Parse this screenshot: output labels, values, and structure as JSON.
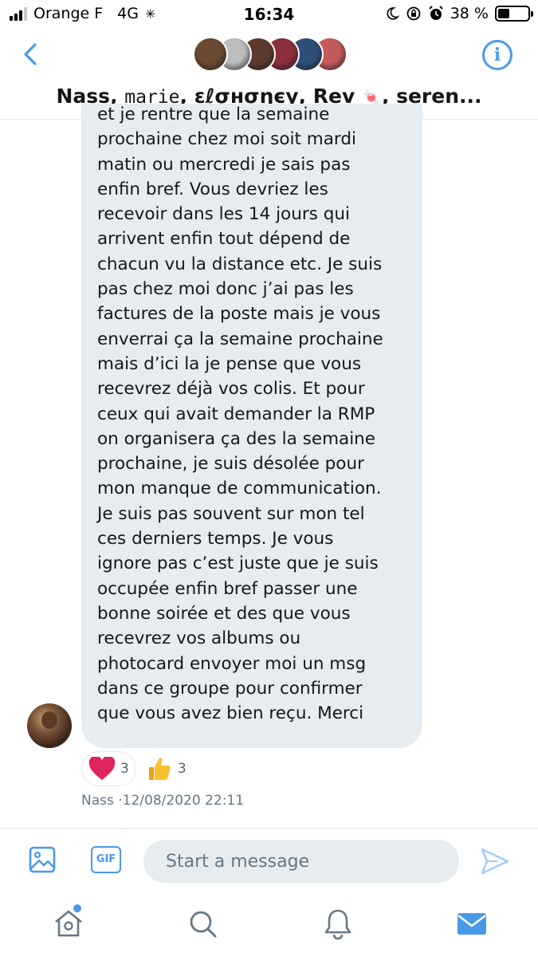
{
  "status_bar": {
    "carrier": "Orange F",
    "network": "4G",
    "time": "16:34",
    "battery_percent": "38 %",
    "battery_level": 0.38
  },
  "header": {
    "title_parts": [
      "Nass, ",
      "marie",
      ", ɛℓσнσηєу, Rev ",
      "🍬",
      ", seren..."
    ],
    "avatar_colors": [
      "#6b4a32",
      "#bdbdbd",
      "#5c3a2e",
      "#8a2f3c",
      "#2f4f7a",
      "#c45a5a"
    ]
  },
  "message": {
    "lines": [
      "et je rentre que la semaine",
      "prochaine chez moi soit mardi",
      "matin ou mercredi je sais pas",
      "enfin bref. Vous devriez les",
      "recevoir dans les 14 jours qui",
      "arrivent enfin tout dépend de",
      "chacun vu la distance etc. Je suis",
      "pas chez moi donc j’ai pas les",
      "factures de la poste mais je vous",
      "enverrai ça la semaine prochaine",
      "mais d’ici la je pense que vous",
      "recevrez déjà vos colis. Et pour",
      "ceux qui avait demander la RMP",
      "on organisera ça des la semaine",
      "prochaine, je suis désolée pour",
      "mon manque de communication.",
      "Je suis pas souvent sur mon tel",
      "ces derniers temps. Je vous",
      "ignore pas c’est juste que je suis",
      "occupée enfin bref passer une",
      "bonne soirée et des que vous",
      "recevrez vos albums ou",
      "photocard envoyer moi un msg",
      "dans ce groupe pour confirmer",
      "que vous avez bien reçu. Merci"
    ],
    "reactions": [
      {
        "emoji": "heart",
        "count": "3"
      },
      {
        "emoji": "thumbs-up",
        "count": "3"
      }
    ],
    "sender": "Nass",
    "timestamp": "·12/08/2020 22:11"
  },
  "composer": {
    "gif_label": "GIF",
    "placeholder": "Start a message"
  },
  "colors": {
    "accent": "#4a99e9",
    "bubble": "#e6ecf0",
    "heart": "#e0245e"
  }
}
